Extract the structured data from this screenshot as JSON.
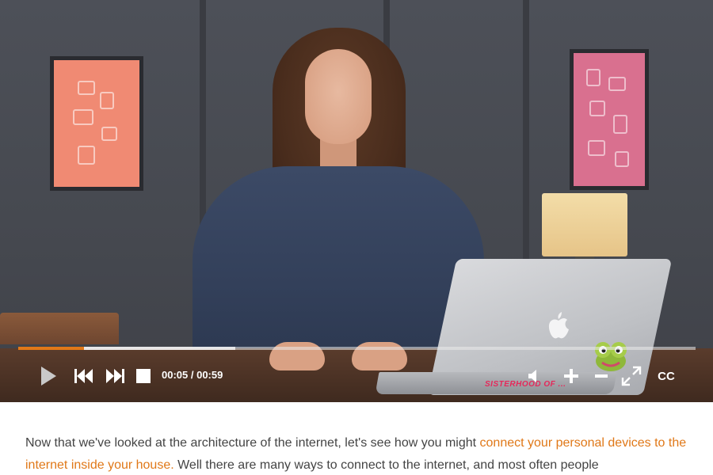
{
  "colors": {
    "accent": "#e07818",
    "progress_played": "#e07818",
    "controls": "#ffffff",
    "body_text": "#444444"
  },
  "player": {
    "current_time": "00:05",
    "duration": "00:59",
    "time_display": "00:05 / 00:59",
    "progress_played_fraction": 0.097,
    "progress_buffered_fraction": 0.32,
    "cc_label": "CC",
    "laptop_sticker_text": "SISTERHOOD OF ..."
  },
  "icons": {
    "play": "play-icon",
    "previous": "skip-back-icon",
    "next": "skip-forward-icon",
    "stop": "stop-icon",
    "volume": "speaker-icon",
    "volume_up": "plus-icon",
    "volume_down": "minus-icon",
    "fullscreen": "fullscreen-icon"
  },
  "transcript": {
    "text_1": "Now that we've looked at the architecture of the internet, let's see how you might ",
    "link_text": "connect your personal devices to the internet inside your house.",
    "text_2": " Well there are many ways to connect to the internet, and most often people"
  }
}
